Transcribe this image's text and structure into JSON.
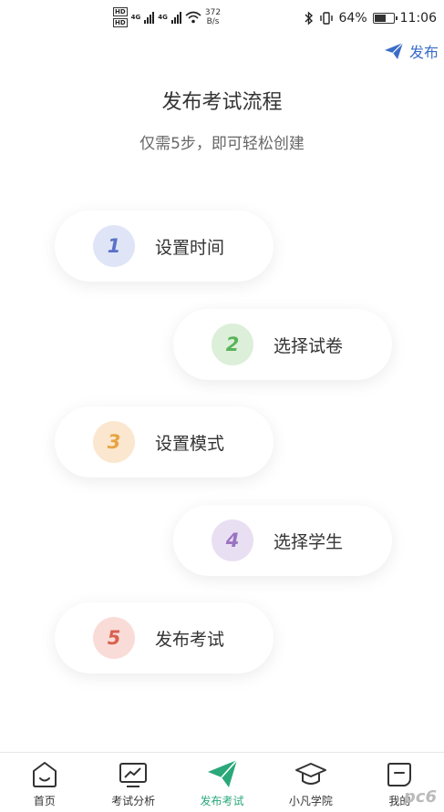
{
  "status_bar": {
    "hd1": "HD",
    "hd2": "HD",
    "net1": "4G",
    "net2": "4G",
    "speed_value": "372",
    "speed_unit": "B/s",
    "battery_percent": "64%",
    "battery_level": 0.64,
    "time": "11:06"
  },
  "header": {
    "publish_label": "发布",
    "accent_color": "#3a6cc9"
  },
  "intro": {
    "title": "发布考试流程",
    "subtitle": "仅需5步，即可轻松创建"
  },
  "steps": [
    {
      "number": "1",
      "label": "设置时间",
      "bg": "#dfe5f7",
      "fg": "#5a72c8"
    },
    {
      "number": "2",
      "label": "选择试卷",
      "bg": "#dcefd9",
      "fg": "#5ab35a"
    },
    {
      "number": "3",
      "label": "设置模式",
      "bg": "#fbe7cf",
      "fg": "#e8a443"
    },
    {
      "number": "4",
      "label": "选择学生",
      "bg": "#e9dff2",
      "fg": "#9a73c2"
    },
    {
      "number": "5",
      "label": "发布考试",
      "bg": "#f9dcd8",
      "fg": "#d9604f"
    }
  ],
  "bottom_nav": {
    "active_color": "#2aa87a",
    "items": [
      {
        "label": "首页",
        "icon": "home-icon"
      },
      {
        "label": "考试分析",
        "icon": "analysis-icon"
      },
      {
        "label": "发布考试",
        "icon": "paper-plane-icon"
      },
      {
        "label": "小凡学院",
        "icon": "graduation-cap-icon"
      },
      {
        "label": "我的",
        "icon": "profile-icon"
      }
    ]
  },
  "watermark": "pc6"
}
